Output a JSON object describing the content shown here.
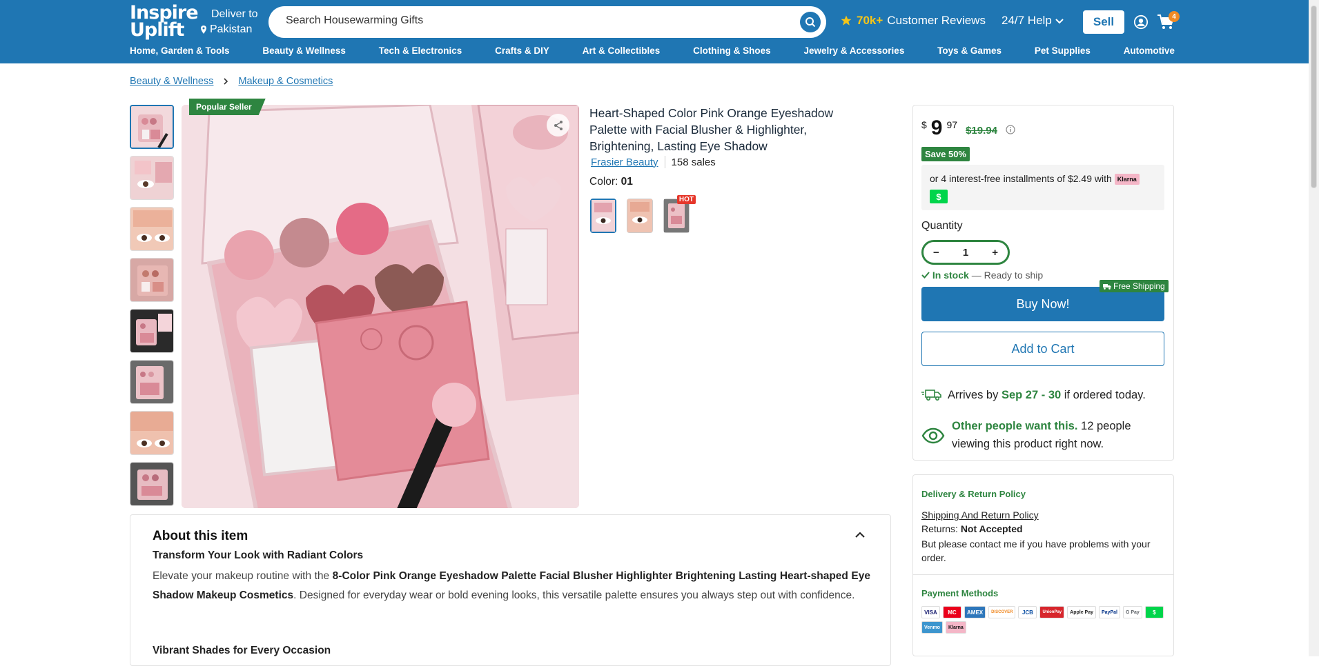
{
  "header": {
    "logo_line1": "Inspire",
    "logo_line2": "Uplift",
    "deliver_label": "Deliver to",
    "deliver_country": "Pakistan",
    "search_placeholder": "Search Housewarming Gifts",
    "reviews_count": "70k+",
    "reviews_label": "Customer Reviews",
    "help_label": "24/7 Help",
    "sell_label": "Sell",
    "cart_count": "4",
    "accent_color": "#1f76b3"
  },
  "categories": [
    "Home, Garden & Tools",
    "Beauty & Wellness",
    "Tech & Electronics",
    "Crafts & DIY",
    "Art & Collectibles",
    "Clothing & Shoes",
    "Jewelry & Accessories",
    "Toys & Games",
    "Pet Supplies",
    "Automotive"
  ],
  "breadcrumb": [
    "Beauty & Wellness",
    "Makeup & Cosmetics"
  ],
  "gallery": {
    "badge": "Popular Seller"
  },
  "product": {
    "title": "Heart-Shaped Color Pink Orange Eyeshadow Palette with Facial Blusher & Highlighter, Brightening, Lasting Eye Shadow",
    "brand": "Frasier Beauty",
    "sales": "158 sales",
    "color_label": "Color:",
    "color_value": "01",
    "hot_label": "HOT"
  },
  "buybox": {
    "currency": "$",
    "price_dollars": "9",
    "price_cents": "97",
    "old_price": "$19.94",
    "save_label": "Save 50%",
    "installments_text": "or 4 interest-free installments of $2.49 with",
    "klarna_label": "Klarna",
    "cashapp_label": "$",
    "quantity_label": "Quantity",
    "quantity_value": "1",
    "stock_label": "In stock",
    "stock_rest": "— Ready to ship",
    "free_shipping": "Free Shipping",
    "buy_now": "Buy Now!",
    "add_to_cart": "Add to Cart",
    "arrives_prefix": "Arrives by",
    "arrives_dates": "Sep 27 - 30",
    "arrives_suffix": "if ordered today.",
    "viewers_bold": "Other people want this.",
    "viewers_rest": "12 people viewing this product right now."
  },
  "policy": {
    "heading": "Delivery & Return Policy",
    "link": "Shipping And Return Policy",
    "returns_label": "Returns:",
    "returns_value": "Not Accepted",
    "note": "But please contact me if you have problems with your order.",
    "payment_heading": "Payment Methods",
    "payment_methods": [
      "VISA",
      "MC",
      "AMEX",
      "DISCOVER",
      "JCB",
      "UnionPay",
      "Apple Pay",
      "PayPal",
      "G Pay",
      "$",
      "Venmo",
      "Klarna"
    ]
  },
  "about": {
    "heading": "About this item",
    "subheading1": "Transform Your Look with Radiant Colors",
    "para_start": "Elevate your makeup routine with the",
    "para_bold": "8-Color Pink Orange Eyeshadow Palette Facial Blusher Highlighter Brightening Lasting Heart-shaped Eye Shadow Makeup Cosmetics",
    "para_end": ". Designed for everyday wear or bold evening looks, this versatile palette ensures you always step out with confidence.",
    "subheading2": "Vibrant Shades for Every Occasion"
  }
}
